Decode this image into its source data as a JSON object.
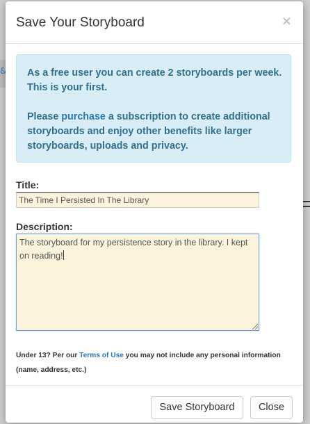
{
  "background": {
    "link_fragment": "&"
  },
  "modal": {
    "title": "Save Your Storyboard",
    "close_symbol": "×"
  },
  "alert": {
    "line1": "As a free user you can create 2 storyboards per week. This is your first.",
    "line2_prefix": "Please ",
    "line2_link": "purchase",
    "line2_suffix": " a subscription to create additional storyboards and enjoy other benefits like larger storyboards, uploads and privacy."
  },
  "form": {
    "title_label": "Title:",
    "title_value": "The Time I Persisted In The Library",
    "description_label": "Description:",
    "description_value": "The storyboard for my persistence story in the library. I kept on reading!"
  },
  "note": {
    "prefix": "Under 13? Per our ",
    "link": "Terms of Use",
    "suffix": " you may not include any personal information (name, address, etc.)"
  },
  "footer": {
    "save_label": "Save Storyboard",
    "close_label": "Close"
  },
  "colors": {
    "alert_bg": "#d9edf7",
    "alert_text": "#31708f",
    "input_bg": "#fcf3dc",
    "link": "#2a78b8"
  }
}
